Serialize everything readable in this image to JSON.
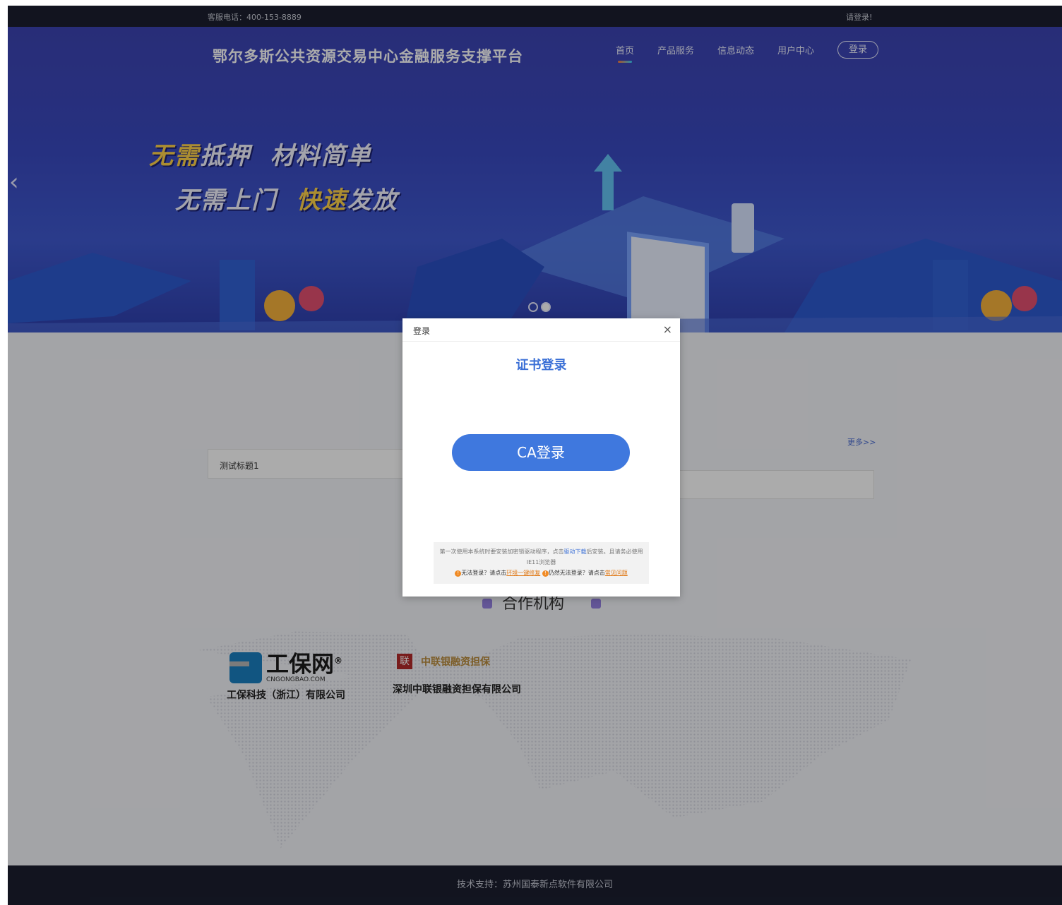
{
  "topbar": {
    "phone": "客服电话：400-153-8889",
    "login_hint": "请登录!"
  },
  "header": {
    "site_title": "鄂尔多斯公共资源交易中心金融服务支撑平台",
    "nav": [
      "首页",
      "产品服务",
      "信息动态",
      "用户中心"
    ],
    "login_button": "登录"
  },
  "banner": {
    "slogan1_a": "无需",
    "slogan1_b": "抵押",
    "slogan1_c": "材料简单",
    "slogan2_a": "无需上门",
    "slogan2_b": "快速",
    "slogan2_c": "发放",
    "prev_arrow": "‹"
  },
  "news": {
    "more": "更多>>",
    "item1": "测试标题1"
  },
  "partners": {
    "title": "合作机构",
    "p1_logo": "工保网",
    "p1_logo_mark": "®",
    "p1_domain": "CNGONGBAO.COM",
    "p1_name": "工保科技（浙江）有限公司",
    "p2_logo_mark": "联",
    "p2_logo": "中联银融资担保",
    "p2_name": "深圳中联银融资担保有限公司"
  },
  "footer": {
    "text": "技术支持：苏州国泰新点软件有限公司"
  },
  "modal": {
    "title": "登录",
    "close": "×",
    "cert_title": "证书登录",
    "ca_button": "CA登录",
    "notice_1": "第一次使用本系统时要安装加密锁驱动程序，点击",
    "notice_link1": "驱动下载",
    "notice_2": "后安装。且请务必使用IE11浏览器",
    "warn_1": "无法登录？请点击",
    "warn_link1": "环境一键修复",
    "warn_2": "仍然无法登录？请点击",
    "warn_link2": "常见问题"
  },
  "colors": {
    "accent": "#3f78de",
    "topbar": "#1b1f2f",
    "banner": "#3f50c4"
  }
}
